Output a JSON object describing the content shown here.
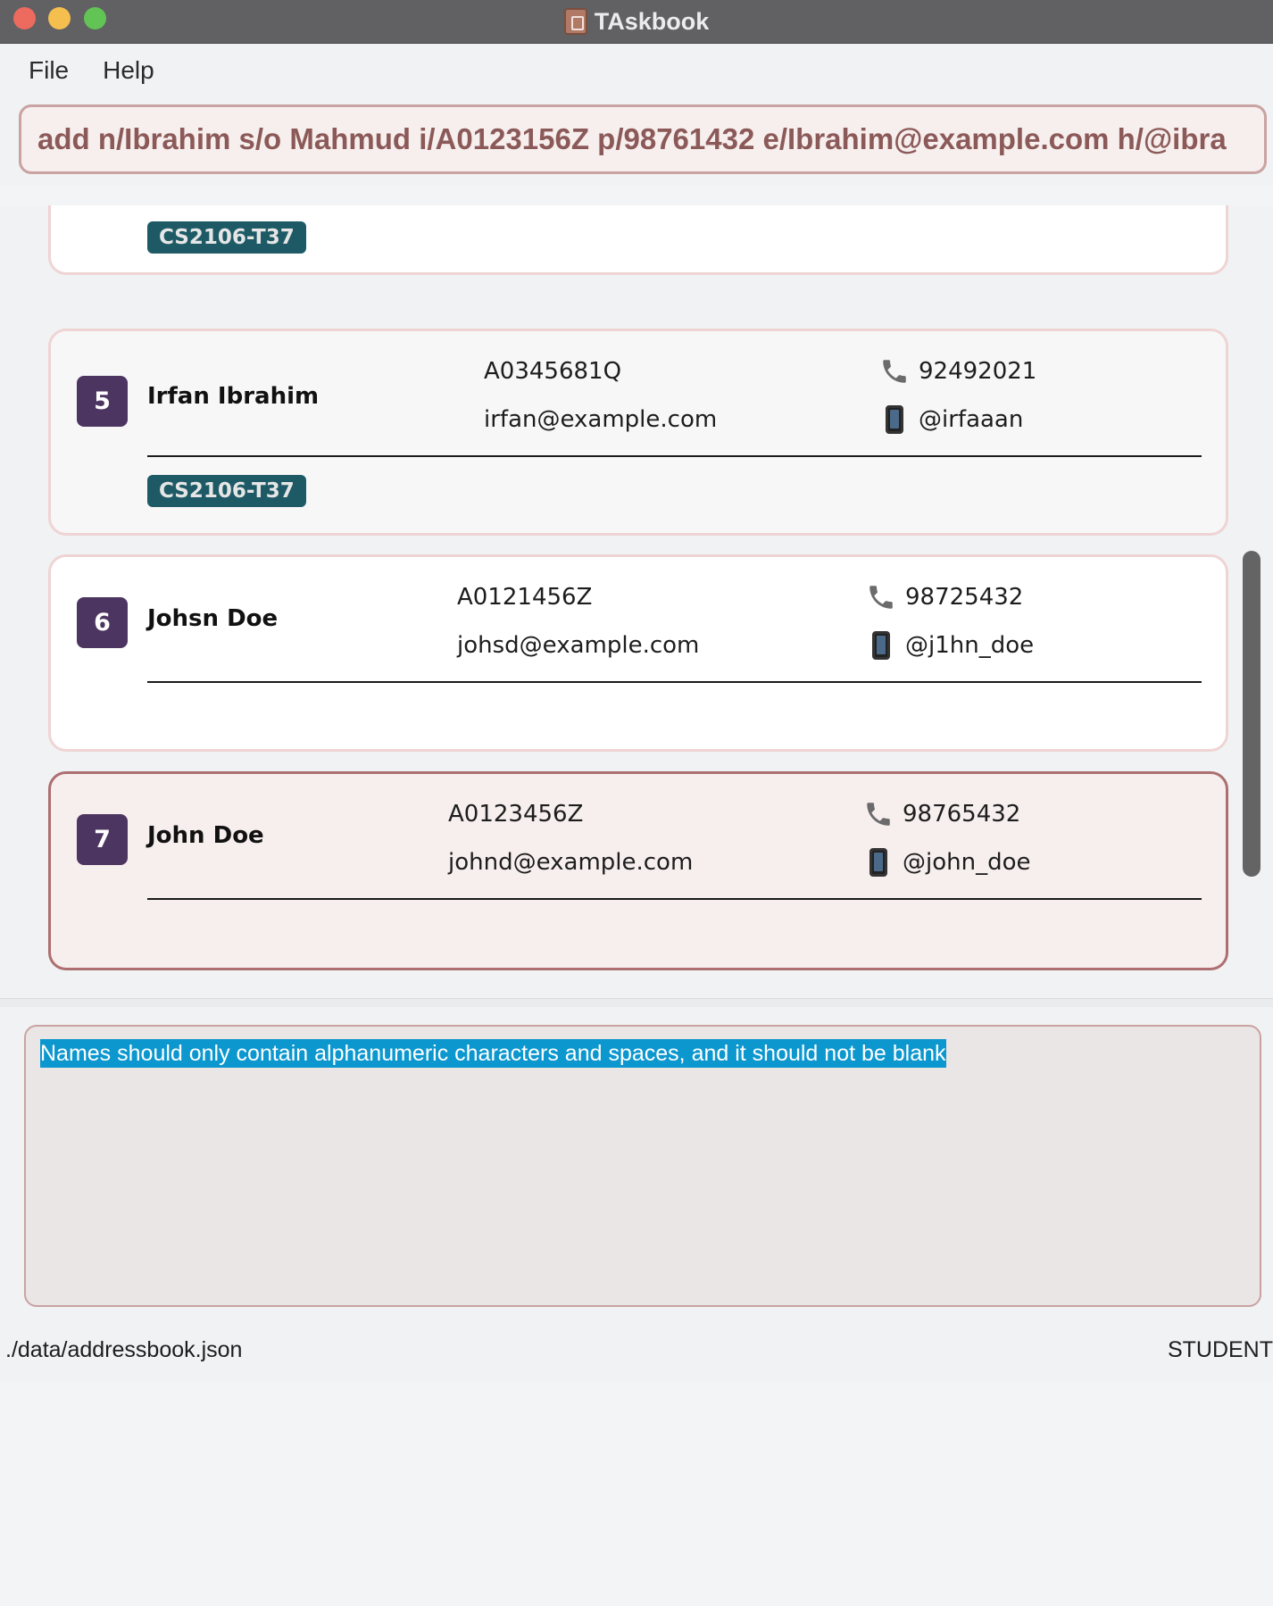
{
  "window": {
    "title": "TAskbook"
  },
  "menu": {
    "items": [
      "File",
      "Help"
    ]
  },
  "command": {
    "value": "add n/Ibrahim s/o Mahmud i/A0123156Z p/98761432 e/Ibrahim@example.com h/@ibra"
  },
  "persons": [
    {
      "tag": "CS2106-T37"
    },
    {
      "index": "5",
      "name": "Irfan Ibrahim",
      "student_id": "A0345681Q",
      "email": "irfan@example.com",
      "phone": "92492021",
      "handle": "@irfaaan",
      "tag": "CS2106-T37"
    },
    {
      "index": "6",
      "name": "Johsn Doe",
      "student_id": "A0121456Z",
      "email": "johsd@example.com",
      "phone": "98725432",
      "handle": "@j1hn_doe"
    },
    {
      "index": "7",
      "name": "John Doe",
      "student_id": "A0123456Z",
      "email": "johnd@example.com",
      "phone": "98765432",
      "handle": "@john_doe"
    }
  ],
  "result": {
    "message": "Names should only contain alphanumeric characters and spaces, and it should not be blank"
  },
  "status": {
    "file_path": "./data/addressbook.json",
    "mode": "STUDENT"
  },
  "colors": {
    "index_badge": "#4d3561",
    "tag": "#1e5a66",
    "selection": "#0c97cf",
    "accent_border": "#ad6f70"
  }
}
